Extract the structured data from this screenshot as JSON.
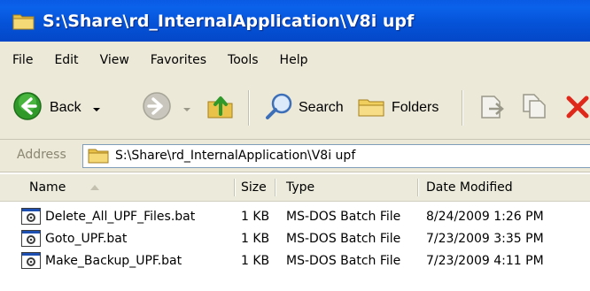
{
  "window": {
    "title": "S:\\Share\\rd_InternalApplication\\V8i upf"
  },
  "menu": [
    "File",
    "Edit",
    "View",
    "Favorites",
    "Tools",
    "Help"
  ],
  "toolbar": {
    "back_label": "Back",
    "search_label": "Search",
    "folders_label": "Folders"
  },
  "address": {
    "label": "Address",
    "value": "S:\\Share\\rd_InternalApplication\\V8i upf"
  },
  "columns": {
    "name": "Name",
    "size": "Size",
    "type": "Type",
    "date": "Date Modified"
  },
  "files": [
    {
      "name": "Delete_All_UPF_Files.bat",
      "size": "1 KB",
      "type": "MS-DOS Batch File",
      "date": "8/24/2009 1:26 PM"
    },
    {
      "name": "Goto_UPF.bat",
      "size": "1 KB",
      "type": "MS-DOS Batch File",
      "date": "7/23/2009 3:35 PM"
    },
    {
      "name": "Make_Backup_UPF.bat",
      "size": "1 KB",
      "type": "MS-DOS Batch File",
      "date": "7/23/2009 4:11 PM"
    }
  ],
  "colors": {
    "titlebar": "#0553d8",
    "chrome": "#ece9d8",
    "back_green": "#2f9a2a",
    "delete_red": "#e0281a"
  }
}
